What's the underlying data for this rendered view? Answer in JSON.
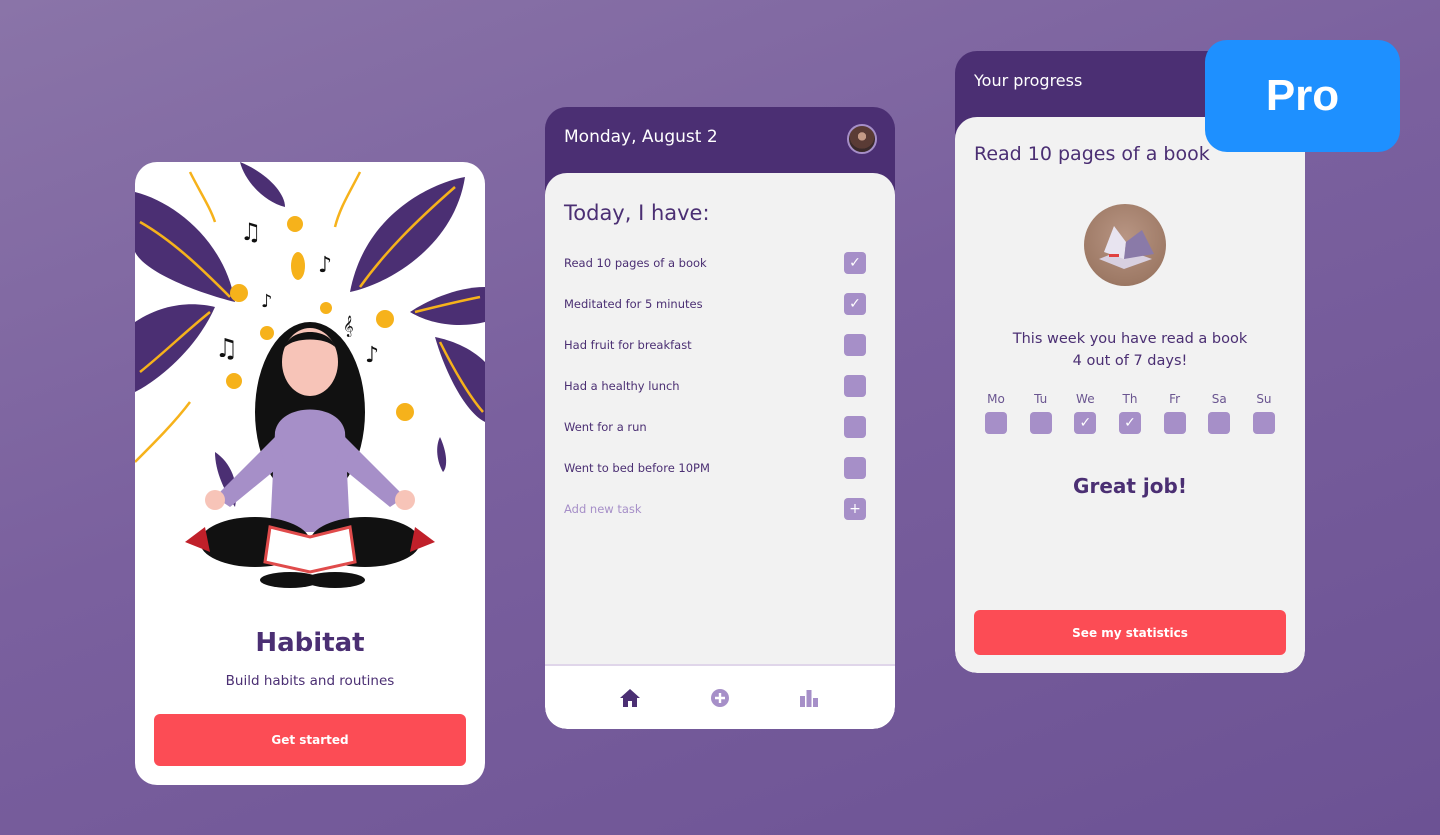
{
  "colors": {
    "primary_purple": "#4b2f73",
    "light_purple": "#a68fc8",
    "accent_red": "#fc4c55",
    "card_bg": "#f2f2f2",
    "pro_blue": "#1e90ff"
  },
  "onboarding": {
    "illustration": "meditating-woman-illustration",
    "title": "Habitat",
    "subtitle": "Build habits and routines",
    "cta_label": "Get started"
  },
  "today": {
    "date": "Monday, August 2",
    "avatar": "user-avatar",
    "heading": "Today, I have:",
    "tasks": [
      {
        "label": "Read 10 pages of a book",
        "checked": true
      },
      {
        "label": "Meditated for 5 minutes",
        "checked": true
      },
      {
        "label": "Had fruit for breakfast",
        "checked": false
      },
      {
        "label": "Had a healthy lunch",
        "checked": false
      },
      {
        "label": "Went for a run",
        "checked": false
      },
      {
        "label": "Went to bed before 10PM",
        "checked": false
      }
    ],
    "add_task_placeholder": "Add new task",
    "nav": [
      {
        "icon": "home-icon",
        "active": true
      },
      {
        "icon": "add-circle-icon",
        "active": false
      },
      {
        "icon": "bar-chart-icon",
        "active": false
      }
    ]
  },
  "progress": {
    "header": "Your progress",
    "habit": "Read 10 pages of a book",
    "habit_image": "open-book-photo",
    "summary_line1": "This week you have read a book",
    "summary_line2": "4 out of 7 days!",
    "days": [
      {
        "label": "Mo",
        "checked": false
      },
      {
        "label": "Tu",
        "checked": false
      },
      {
        "label": "We",
        "checked": true
      },
      {
        "label": "Th",
        "checked": true
      },
      {
        "label": "Fr",
        "checked": false
      },
      {
        "label": "Sa",
        "checked": false
      },
      {
        "label": "Su",
        "checked": false
      }
    ],
    "praise": "Great job!",
    "cta_label": "See my statistics"
  },
  "badge": {
    "label": "Pro"
  }
}
